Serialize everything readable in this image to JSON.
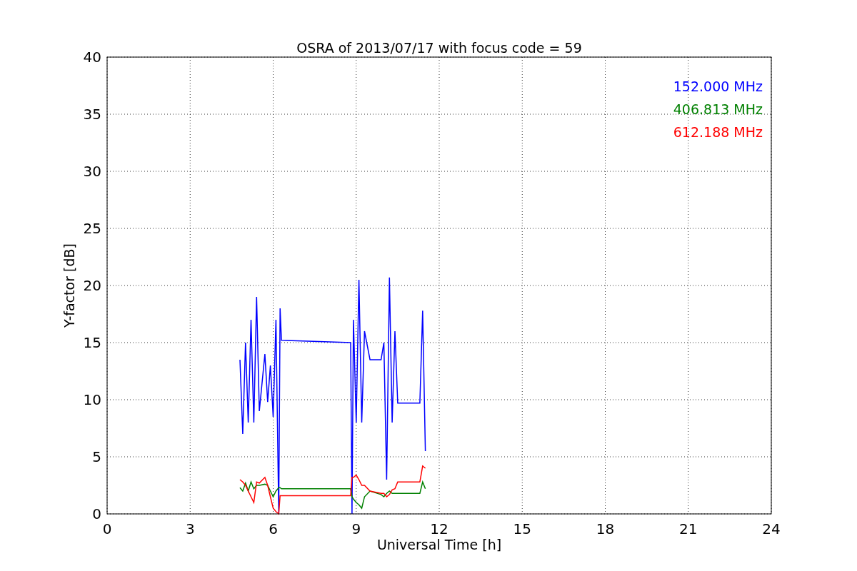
{
  "chart_data": {
    "type": "line",
    "title": "OSRA of 2013/07/17 with focus code = 59",
    "xlabel": "Universal Time [h]",
    "ylabel": "Y-factor [dB]",
    "x": [
      4.8,
      4.9,
      5.0,
      5.1,
      5.2,
      5.3,
      5.4,
      5.5,
      5.7,
      5.8,
      5.9,
      6.0,
      6.1,
      6.2,
      6.25,
      6.3,
      8.8,
      8.85,
      8.9,
      9.0,
      9.1,
      9.2,
      9.3,
      9.5,
      9.9,
      10.0,
      10.1,
      10.2,
      10.3,
      10.4,
      10.5,
      11.3,
      11.4,
      11.5
    ],
    "series": [
      {
        "name": "152.000 MHz",
        "color": "#0000ff",
        "values": [
          13.5,
          7,
          15,
          8,
          17,
          8,
          19,
          9,
          14,
          9.8,
          13,
          8.5,
          17,
          0,
          18,
          15.2,
          15,
          0,
          17,
          8,
          20.5,
          8,
          16,
          13.5,
          13.5,
          15,
          3,
          20.7,
          8,
          16,
          9.7,
          9.7,
          17.8,
          5.5
        ]
      },
      {
        "name": "406.813 MHz",
        "color": "#008000",
        "values": [
          2.3,
          2,
          2.7,
          2,
          2.8,
          2.2,
          2.5,
          2.5,
          2.6,
          2.5,
          2,
          1.5,
          2,
          2.3,
          2.3,
          2.2,
          2.2,
          1.5,
          1.3,
          1,
          0.8,
          0.5,
          1.5,
          2,
          1.7,
          1.5,
          1.8,
          2,
          1.8,
          1.8,
          1.8,
          1.8,
          2.8,
          2.2
        ]
      },
      {
        "name": "612.188 MHz",
        "color": "#ff0000",
        "values": [
          3,
          2.8,
          2.5,
          2,
          1.5,
          1,
          2.8,
          2.7,
          3.2,
          2.5,
          1.5,
          0.5,
          0.2,
          0,
          1.6,
          1.6,
          1.6,
          3.2,
          3.2,
          3.4,
          3,
          2.5,
          2.5,
          2,
          1.8,
          1.8,
          1.5,
          1.7,
          2.1,
          2.2,
          2.8,
          2.8,
          4.2,
          4
        ]
      }
    ],
    "grid": true,
    "xlim": [
      0,
      24
    ],
    "ylim": [
      0,
      40
    ],
    "xticks": [
      0,
      3,
      6,
      9,
      12,
      15,
      18,
      21,
      24
    ],
    "yticks": [
      0,
      5,
      10,
      15,
      20,
      25,
      30,
      35,
      40
    ]
  }
}
